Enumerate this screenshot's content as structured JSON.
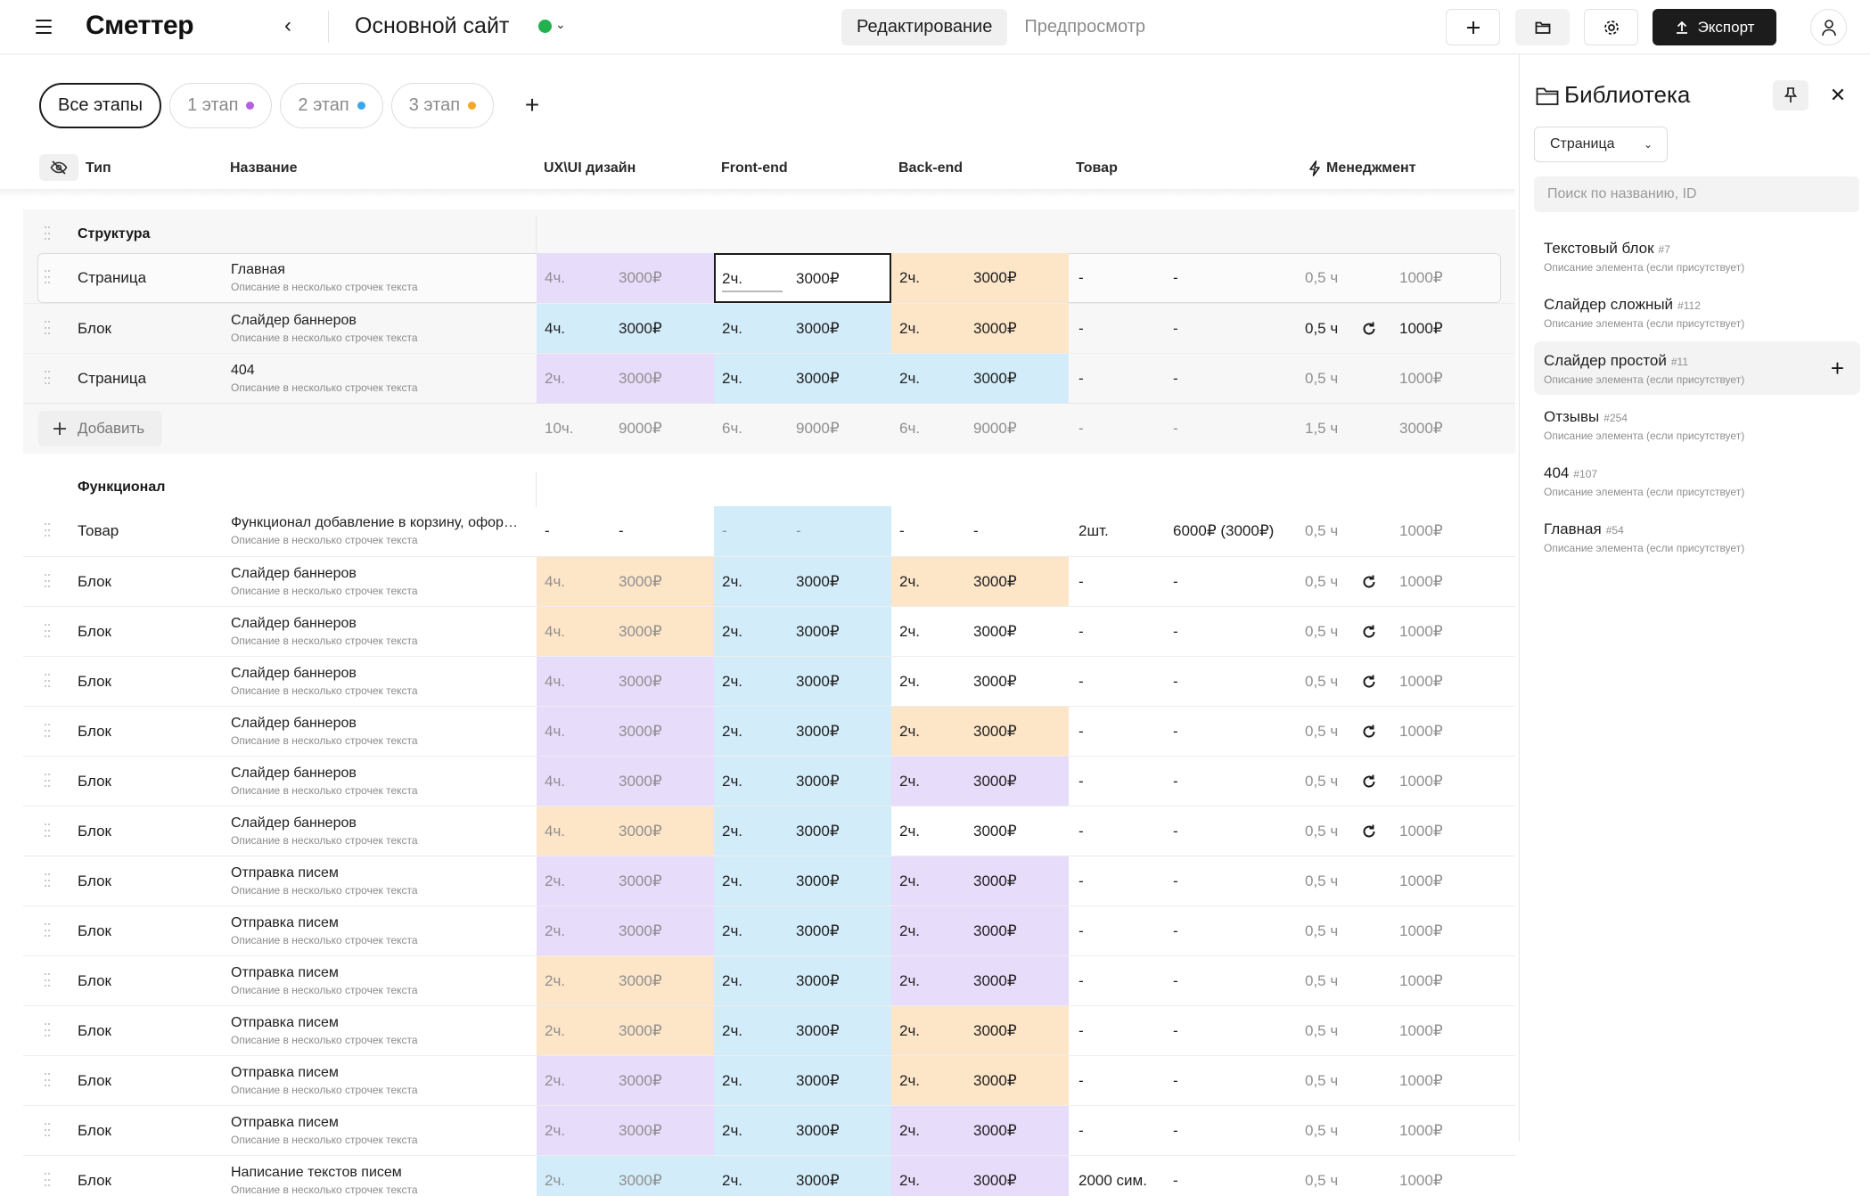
{
  "header": {
    "logo": "Сметтер",
    "site_title": "Основной сайт",
    "site_status_color": "#22b14c",
    "modes": [
      {
        "label": "Редактирование",
        "active": true
      },
      {
        "label": "Предпросмотр",
        "active": false
      }
    ],
    "export_label": "Экспорт",
    "icons": [
      "menu-icon",
      "chevron-left-icon",
      "plus-icon",
      "folder-icon",
      "gear-icon",
      "upload-icon",
      "user-icon"
    ]
  },
  "stages": [
    {
      "label": "Все этапы",
      "active": true,
      "dot": null
    },
    {
      "label": "1 этап",
      "active": false,
      "dot": "#b35fe0"
    },
    {
      "label": "2 этап",
      "active": false,
      "dot": "#38a7f0"
    },
    {
      "label": "3 этап",
      "active": false,
      "dot": "#f5a623"
    }
  ],
  "columns": {
    "type": "Тип",
    "name": "Название",
    "ux": "UX\\UI дизайн",
    "frontend": "Front-end",
    "backend": "Back-end",
    "product": "Товар",
    "management": "Менеджмент"
  },
  "colors": {
    "violet": "#e8dcfb",
    "blue": "#d3ecfa",
    "peach": "#fde5c8"
  },
  "sections": {
    "structure": {
      "title": "Структура",
      "rows": [
        {
          "type": "Страница",
          "name": "Главная",
          "desc": "Описание в несколько строчек текста",
          "ux": [
            "4ч.",
            "3000₽"
          ],
          "fe": [
            "2ч.",
            "3000₽"
          ],
          "be": [
            "2ч.",
            "3000₽"
          ],
          "prod": [
            "-",
            "-"
          ],
          "mgm": [
            "0,5 ч",
            "1000₽"
          ]
        },
        {
          "type": "Блок",
          "name": "Слайдер баннеров",
          "desc": "Описание в несколько строчек текста",
          "ux": [
            "4ч.",
            "3000₽"
          ],
          "fe": [
            "2ч.",
            "3000₽"
          ],
          "be": [
            "2ч.",
            "3000₽"
          ],
          "prod": [
            "-",
            "-"
          ],
          "mgm": [
            "0,5 ч",
            "1000₽"
          ]
        },
        {
          "type": "Страница",
          "name": "404",
          "desc": "Описание в несколько строчек текста",
          "ux": [
            "2ч.",
            "3000₽"
          ],
          "fe": [
            "2ч.",
            "3000₽"
          ],
          "be": [
            "2ч.",
            "3000₽"
          ],
          "prod": [
            "-",
            "-"
          ],
          "mgm": [
            "0,5 ч",
            "1000₽"
          ]
        }
      ],
      "add_label": "Добавить",
      "totals": {
        "ux": [
          "10ч.",
          "9000₽"
        ],
        "fe": [
          "6ч.",
          "9000₽"
        ],
        "be": [
          "6ч.",
          "9000₽"
        ],
        "prod": [
          "-",
          "-"
        ],
        "mgm": [
          "1,5 ч",
          "3000₽"
        ]
      }
    },
    "functional": {
      "title": "Функционал",
      "rows": [
        {
          "type": "Товар",
          "name": "Функционал добавление в корзину, оформление заказа",
          "desc": "Описание в несколько строчек текста",
          "ux": [
            "-",
            "-"
          ],
          "fe": [
            "-",
            "-"
          ],
          "be": [
            "-",
            "-"
          ],
          "prod": [
            "2шт.",
            "6000₽ (3000₽)"
          ],
          "mgm": [
            "0,5 ч",
            "1000₽"
          ]
        },
        {
          "type": "Блок",
          "name": "Слайдер баннеров",
          "desc": "Описание в несколько строчек текста",
          "ux": [
            "4ч.",
            "3000₽"
          ],
          "fe": [
            "2ч.",
            "3000₽"
          ],
          "be": [
            "2ч.",
            "3000₽"
          ],
          "prod": [
            "-",
            "-"
          ],
          "mgm": [
            "0,5 ч",
            "1000₽"
          ]
        },
        {
          "type": "Блок",
          "name": "Слайдер баннеров",
          "desc": "Описание в несколько строчек текста",
          "ux": [
            "4ч.",
            "3000₽"
          ],
          "fe": [
            "2ч.",
            "3000₽"
          ],
          "be": [
            "2ч.",
            "3000₽"
          ],
          "prod": [
            "-",
            "-"
          ],
          "mgm": [
            "0,5 ч",
            "1000₽"
          ]
        },
        {
          "type": "Блок",
          "name": "Слайдер баннеров",
          "desc": "Описание в несколько строчек текста",
          "ux": [
            "4ч.",
            "3000₽"
          ],
          "fe": [
            "2ч.",
            "3000₽"
          ],
          "be": [
            "2ч.",
            "3000₽"
          ],
          "prod": [
            "-",
            "-"
          ],
          "mgm": [
            "0,5 ч",
            "1000₽"
          ]
        },
        {
          "type": "Блок",
          "name": "Слайдер баннеров",
          "desc": "Описание в несколько строчек текста",
          "ux": [
            "4ч.",
            "3000₽"
          ],
          "fe": [
            "2ч.",
            "3000₽"
          ],
          "be": [
            "2ч.",
            "3000₽"
          ],
          "prod": [
            "-",
            "-"
          ],
          "mgm": [
            "0,5 ч",
            "1000₽"
          ]
        },
        {
          "type": "Блок",
          "name": "Слайдер баннеров",
          "desc": "Описание в несколько строчек текста",
          "ux": [
            "4ч.",
            "3000₽"
          ],
          "fe": [
            "2ч.",
            "3000₽"
          ],
          "be": [
            "2ч.",
            "3000₽"
          ],
          "prod": [
            "-",
            "-"
          ],
          "mgm": [
            "0,5 ч",
            "1000₽"
          ]
        },
        {
          "type": "Блок",
          "name": "Слайдер баннеров",
          "desc": "Описание в несколько строчек текста",
          "ux": [
            "4ч.",
            "3000₽"
          ],
          "fe": [
            "2ч.",
            "3000₽"
          ],
          "be": [
            "2ч.",
            "3000₽"
          ],
          "prod": [
            "-",
            "-"
          ],
          "mgm": [
            "0,5 ч",
            "1000₽"
          ]
        },
        {
          "type": "Блок",
          "name": "Отправка писем",
          "desc": "Описание в несколько строчек текста",
          "ux": [
            "2ч.",
            "3000₽"
          ],
          "fe": [
            "2ч.",
            "3000₽"
          ],
          "be": [
            "2ч.",
            "3000₽"
          ],
          "prod": [
            "-",
            "-"
          ],
          "mgm": [
            "0,5 ч",
            "1000₽"
          ]
        },
        {
          "type": "Блок",
          "name": "Отправка писем",
          "desc": "Описание в несколько строчек текста",
          "ux": [
            "2ч.",
            "3000₽"
          ],
          "fe": [
            "2ч.",
            "3000₽"
          ],
          "be": [
            "2ч.",
            "3000₽"
          ],
          "prod": [
            "-",
            "-"
          ],
          "mgm": [
            "0,5 ч",
            "1000₽"
          ]
        },
        {
          "type": "Блок",
          "name": "Отправка писем",
          "desc": "Описание в несколько строчек текста",
          "ux": [
            "2ч.",
            "3000₽"
          ],
          "fe": [
            "2ч.",
            "3000₽"
          ],
          "be": [
            "2ч.",
            "3000₽"
          ],
          "prod": [
            "-",
            "-"
          ],
          "mgm": [
            "0,5 ч",
            "1000₽"
          ]
        },
        {
          "type": "Блок",
          "name": "Отправка писем",
          "desc": "Описание в несколько строчек текста",
          "ux": [
            "2ч.",
            "3000₽"
          ],
          "fe": [
            "2ч.",
            "3000₽"
          ],
          "be": [
            "2ч.",
            "3000₽"
          ],
          "prod": [
            "-",
            "-"
          ],
          "mgm": [
            "0,5 ч",
            "1000₽"
          ]
        },
        {
          "type": "Блок",
          "name": "Отправка писем",
          "desc": "Описание в несколько строчек текста",
          "ux": [
            "2ч.",
            "3000₽"
          ],
          "fe": [
            "2ч.",
            "3000₽"
          ],
          "be": [
            "2ч.",
            "3000₽"
          ],
          "prod": [
            "-",
            "-"
          ],
          "mgm": [
            "0,5 ч",
            "1000₽"
          ]
        },
        {
          "type": "Блок",
          "name": "Отправка писем",
          "desc": "Описание в несколько строчек текста",
          "ux": [
            "2ч.",
            "3000₽"
          ],
          "fe": [
            "2ч.",
            "3000₽"
          ],
          "be": [
            "2ч.",
            "3000₽"
          ],
          "prod": [
            "-",
            "-"
          ],
          "mgm": [
            "0,5 ч",
            "1000₽"
          ]
        },
        {
          "type": "Блок",
          "name": "Написание текстов писем",
          "desc": "Описание в несколько строчек текста",
          "ux": [
            "2ч.",
            "3000₽"
          ],
          "fe": [
            "2ч.",
            "3000₽"
          ],
          "be": [
            "2ч.",
            "3000₽"
          ],
          "prod": [
            "2000 сим.",
            "-"
          ],
          "mgm": [
            "0,5 ч",
            "1000₽"
          ]
        }
      ]
    }
  },
  "library": {
    "title": "Библиотека",
    "filter_value": "Страница",
    "search_placeholder": "Поиск по названию, ID",
    "items": [
      {
        "name": "Текстовый блок",
        "id": "#7",
        "desc": "Описание элемента (если присутствует)"
      },
      {
        "name": "Слайдер сложный",
        "id": "#112",
        "desc": "Описание элемента (если присутствует)"
      },
      {
        "name": "Слайдер простой",
        "id": "#11",
        "desc": "Описание элемента (если присутствует)"
      },
      {
        "name": "Отзывы",
        "id": "#254",
        "desc": "Описание элемента (если присутствует)"
      },
      {
        "name": "404",
        "id": "#107",
        "desc": "Описание элемента (если присутствует)"
      },
      {
        "name": "Главная",
        "id": "#54",
        "desc": "Описание элемента (если присутствует)"
      }
    ]
  }
}
